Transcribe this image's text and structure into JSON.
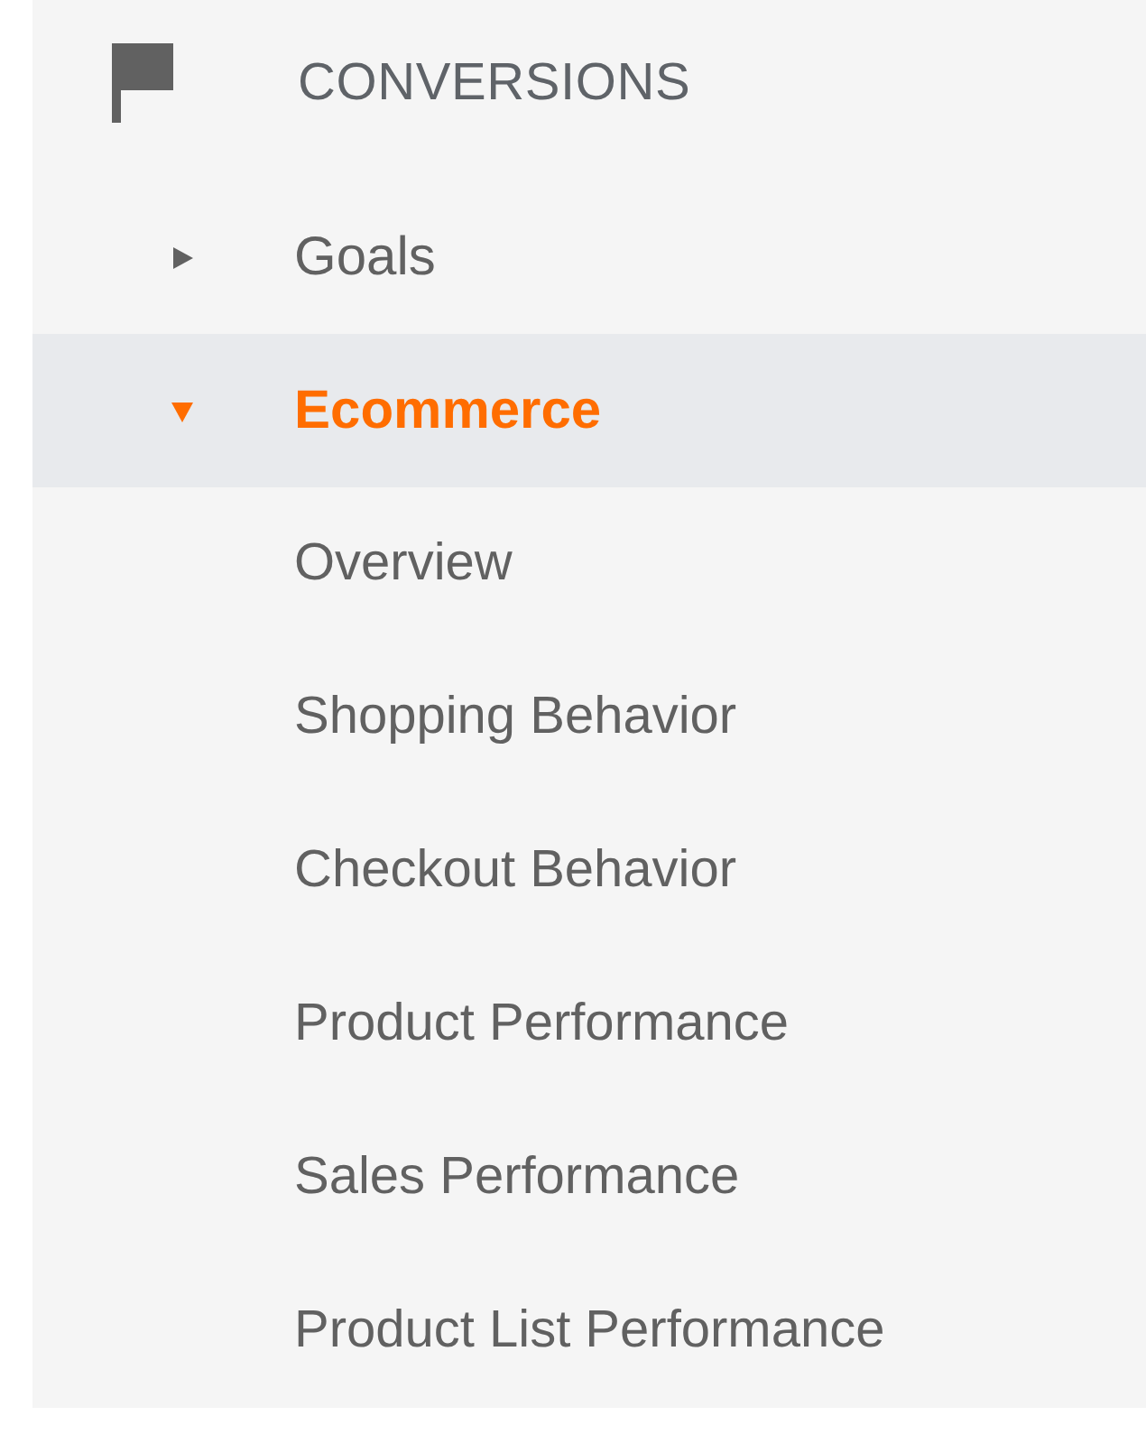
{
  "section": {
    "title": "CONVERSIONS"
  },
  "items": [
    {
      "label": "Goals",
      "expanded": false,
      "selected": false
    },
    {
      "label": "Ecommerce",
      "expanded": true,
      "selected": true,
      "children": [
        {
          "label": "Overview",
          "selected": false
        },
        {
          "label": "Shopping Behavior",
          "selected": false
        },
        {
          "label": "Checkout Behavior",
          "selected": false
        },
        {
          "label": "Product Performance",
          "selected": false
        },
        {
          "label": "Sales Performance",
          "selected": false
        },
        {
          "label": "Product List Performance",
          "selected": false
        }
      ]
    }
  ]
}
